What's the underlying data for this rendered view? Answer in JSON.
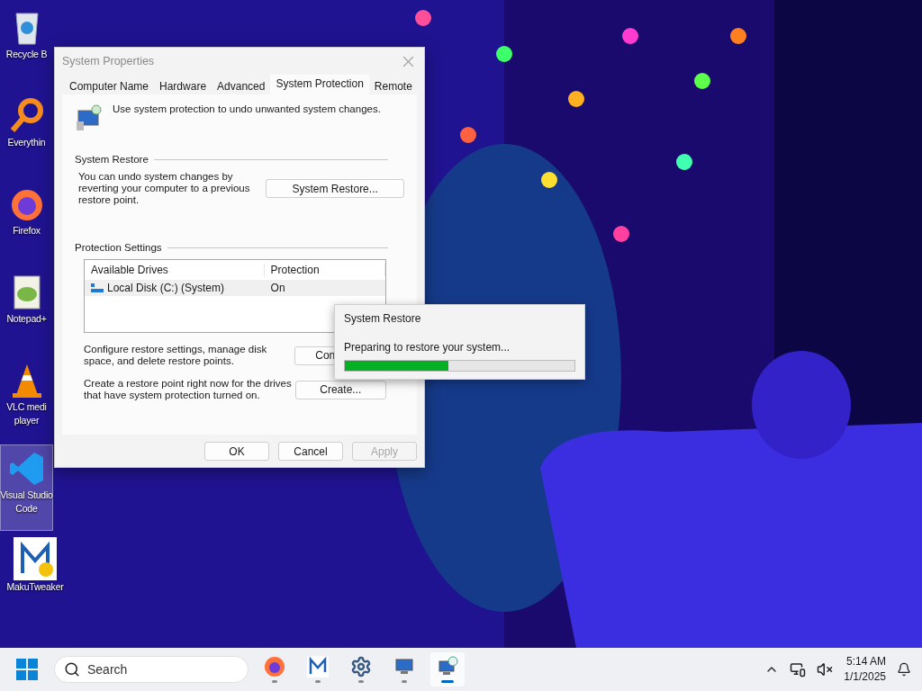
{
  "desktop_icons": [
    {
      "kind": "recycle",
      "label": "Recycle B",
      "selected": false
    },
    {
      "kind": "search-app",
      "label": "Everythin",
      "selected": false
    },
    {
      "kind": "firefox",
      "label": "Firefox",
      "selected": false
    },
    {
      "kind": "notepad",
      "label": "Notepad+",
      "selected": false
    },
    {
      "kind": "vlc",
      "label": "VLC medi\nplayer",
      "selected": false
    },
    {
      "kind": "vscode",
      "label": "Visual Studio\nCode",
      "selected": true
    },
    {
      "kind": "maku",
      "label": "MakuTweaker",
      "selected": false
    }
  ],
  "dialog": {
    "title": "System Properties",
    "tabs": [
      {
        "label": "Computer Name",
        "selected": false
      },
      {
        "label": "Hardware",
        "selected": false
      },
      {
        "label": "Advanced",
        "selected": false
      },
      {
        "label": "System Protection",
        "selected": true
      },
      {
        "label": "Remote",
        "selected": false
      }
    ],
    "description": "Use system protection to undo unwanted system changes.",
    "system_restore": {
      "heading": "System Restore",
      "text": "You can undo system changes by reverting your computer to a previous restore point.",
      "button": "System Restore..."
    },
    "protection_settings": {
      "heading": "Protection Settings",
      "columns": [
        "Available Drives",
        "Protection"
      ],
      "rows": [
        {
          "drive": "Local Disk (C:) (System)",
          "protection": "On",
          "selected": true
        }
      ],
      "configure_text": "Configure restore settings, manage disk space, and delete restore points.",
      "configure_button": "Con",
      "create_text": "Create a restore point right now for the drives that have system protection turned on.",
      "create_button": "Create..."
    },
    "buttons": [
      {
        "label": "OK",
        "disabled": false
      },
      {
        "label": "Cancel",
        "disabled": false
      },
      {
        "label": "Apply",
        "disabled": true
      }
    ]
  },
  "progress_dialog": {
    "title": "System Restore",
    "message": "Preparing to restore your system...",
    "level": 0.45
  },
  "taskbar": {
    "search_placeholder": "Search",
    "apps": [
      {
        "kind": "firefox",
        "active": false
      },
      {
        "kind": "maku",
        "active": false
      },
      {
        "kind": "settings",
        "active": false
      },
      {
        "kind": "sysprops",
        "active": false
      },
      {
        "kind": "restore",
        "active": true
      }
    ],
    "time": "5:14 AM",
    "date": "1/1/2025"
  }
}
